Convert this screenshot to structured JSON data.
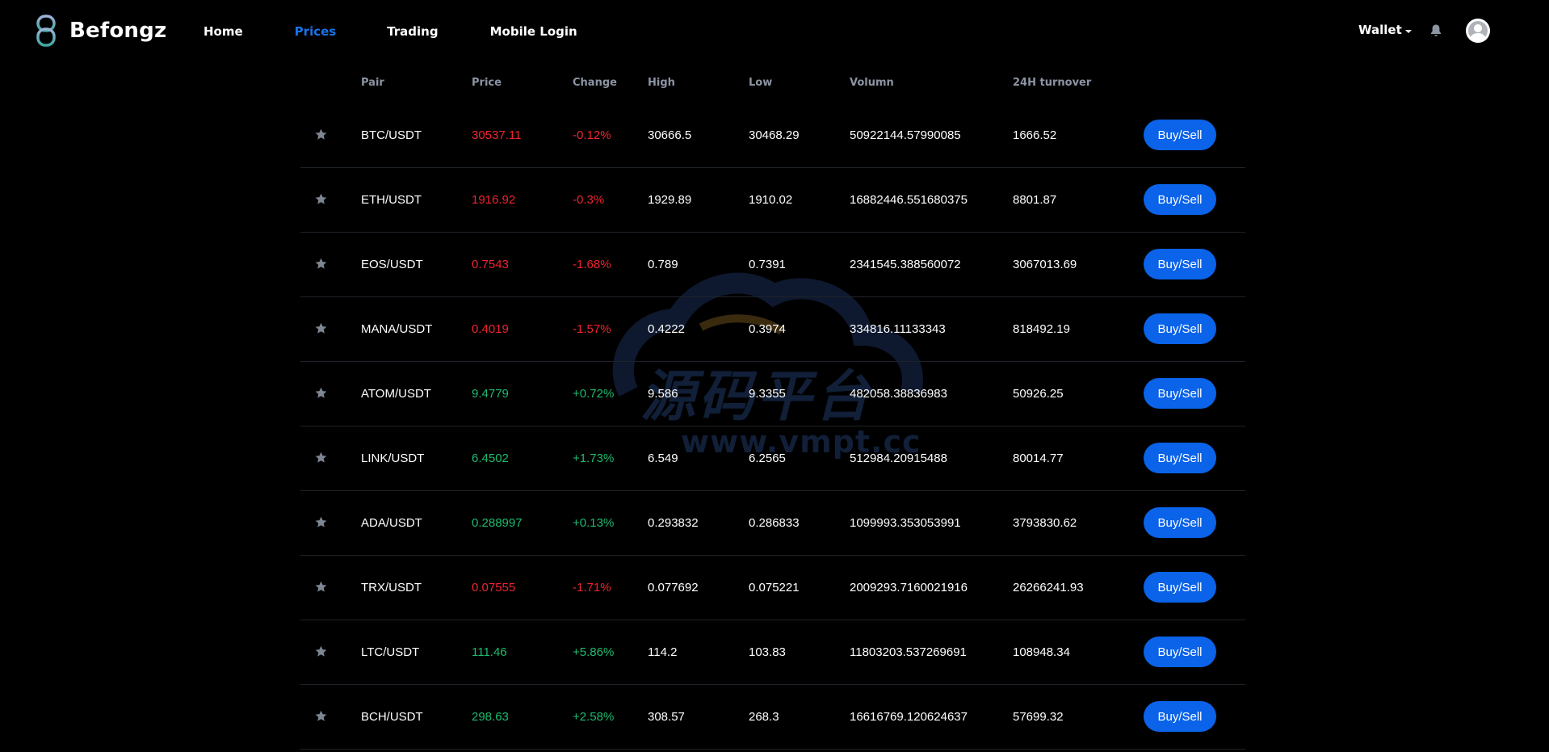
{
  "brand": {
    "name": "Befongz"
  },
  "nav": [
    {
      "label": "Home",
      "active": false
    },
    {
      "label": "Prices",
      "active": true
    },
    {
      "label": "Trading",
      "active": false
    },
    {
      "label": "Mobile Login",
      "active": false
    }
  ],
  "header_right": {
    "wallet_label": "Wallet",
    "icons": [
      "bell-icon",
      "user-avatar-icon"
    ]
  },
  "table": {
    "columns": [
      "Pair",
      "Price",
      "Change",
      "High",
      "Low",
      "Volumn",
      "24H turnover"
    ],
    "action_label": "Buy/Sell",
    "rows": [
      {
        "pair": "BTC/USDT",
        "price": "30537.11",
        "change": "-0.12%",
        "high": "30666.5",
        "low": "30468.29",
        "volume": "50922144.57990085",
        "turnover": "1666.52",
        "trend": "down"
      },
      {
        "pair": "ETH/USDT",
        "price": "1916.92",
        "change": "-0.3%",
        "high": "1929.89",
        "low": "1910.02",
        "volume": "16882446.551680375",
        "turnover": "8801.87",
        "trend": "down"
      },
      {
        "pair": "EOS/USDT",
        "price": "0.7543",
        "change": "-1.68%",
        "high": "0.789",
        "low": "0.7391",
        "volume": "2341545.388560072",
        "turnover": "3067013.69",
        "trend": "down"
      },
      {
        "pair": "MANA/USDT",
        "price": "0.4019",
        "change": "-1.57%",
        "high": "0.4222",
        "low": "0.3974",
        "volume": "334816.11133343",
        "turnover": "818492.19",
        "trend": "down"
      },
      {
        "pair": "ATOM/USDT",
        "price": "9.4779",
        "change": "+0.72%",
        "high": "9.586",
        "low": "9.3355",
        "volume": "482058.38836983",
        "turnover": "50926.25",
        "trend": "up"
      },
      {
        "pair": "LINK/USDT",
        "price": "6.4502",
        "change": "+1.73%",
        "high": "6.549",
        "low": "6.2565",
        "volume": "512984.20915488",
        "turnover": "80014.77",
        "trend": "up"
      },
      {
        "pair": "ADA/USDT",
        "price": "0.288997",
        "change": "+0.13%",
        "high": "0.293832",
        "low": "0.286833",
        "volume": "1099993.353053991",
        "turnover": "3793830.62",
        "trend": "up"
      },
      {
        "pair": "TRX/USDT",
        "price": "0.07555",
        "change": "-1.71%",
        "high": "0.077692",
        "low": "0.075221",
        "volume": "2009293.7160021916",
        "turnover": "26266241.93",
        "trend": "down"
      },
      {
        "pair": "LTC/USDT",
        "price": "111.46",
        "change": "+5.86%",
        "high": "114.2",
        "low": "103.83",
        "volume": "11803203.537269691",
        "turnover": "108948.34",
        "trend": "up"
      },
      {
        "pair": "BCH/USDT",
        "price": "298.63",
        "change": "+2.58%",
        "high": "308.57",
        "low": "268.3",
        "volume": "16616769.120624637",
        "turnover": "57699.32",
        "trend": "up"
      }
    ]
  },
  "watermark": {
    "cn_text": "源码平台",
    "url": "www.vmpt.cc"
  },
  "colors": {
    "background": "#000000",
    "accent": "#1a73e8",
    "button": "#0a63e8",
    "negative": "#f0232f",
    "positive": "#1dbb6f",
    "header_text": "#8c94a3",
    "divider": "#1e2329"
  }
}
